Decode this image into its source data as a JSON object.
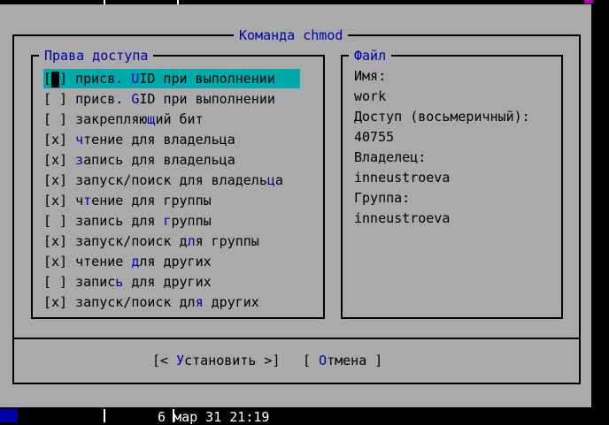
{
  "dialog": {
    "title": "Команда chmod",
    "permissions_title": "Права доступа",
    "file_title": "Файл"
  },
  "permissions": [
    {
      "check": "[ ]",
      "pre": "присв. ",
      "hk": "U",
      "post": "ID при выполнении",
      "checked": false,
      "selected": true
    },
    {
      "check": "[ ]",
      "pre": "присв. ",
      "hk": "G",
      "post": "ID при выполнении",
      "checked": false
    },
    {
      "check": "[ ]",
      "pre": "закрепляю",
      "hk": "щ",
      "post": "ий бит",
      "checked": false
    },
    {
      "check": "[x]",
      "pre": "",
      "hk": "ч",
      "post": "тение для владельца",
      "checked": true
    },
    {
      "check": "[x]",
      "pre": "",
      "hk": "з",
      "post": "апись для владельца",
      "checked": true
    },
    {
      "check": "[x]",
      "pre": "запуск/поиск для владель",
      "hk": "ц",
      "post": "а",
      "checked": true
    },
    {
      "check": "[x]",
      "pre": "ч",
      "hk": "т",
      "post": "ение для группы",
      "checked": true
    },
    {
      "check": "[ ]",
      "pre": "запись для ",
      "hk": "г",
      "post": "руппы",
      "checked": false
    },
    {
      "check": "[x]",
      "pre": "запуск/поиск д",
      "hk": "л",
      "post": "я группы",
      "checked": true
    },
    {
      "check": "[x]",
      "pre": "чтение ",
      "hk": "д",
      "post": "ля других",
      "checked": true
    },
    {
      "check": "[ ]",
      "pre": "запис",
      "hk": "ь",
      "post": " для других",
      "checked": false
    },
    {
      "check": "[x]",
      "pre": "запуск/поиск дл",
      "hk": "я",
      "post": " других",
      "checked": true
    }
  ],
  "file": {
    "name_label": "Имя:",
    "name": "work",
    "access_label": "Доступ (восьмеричный):",
    "access": "40755",
    "owner_label": "Владелец:",
    "owner": "inneustroeva",
    "group_label": "Группа:",
    "group": "inneustroeva"
  },
  "buttons": {
    "set": {
      "pre": "[< ",
      "hk": "У",
      "post": "становить >]"
    },
    "cancel": {
      "pre": "[ ",
      "hk": "О",
      "post": "тмена ]"
    }
  },
  "background": {
    "bottom_text": "6 мар 31 21:19"
  },
  "colors": {
    "dialog_bg": "#aaaaaa",
    "title_blue": "#0000aa",
    "selection": "#00aaaa",
    "terminal_bg": "#000000"
  }
}
